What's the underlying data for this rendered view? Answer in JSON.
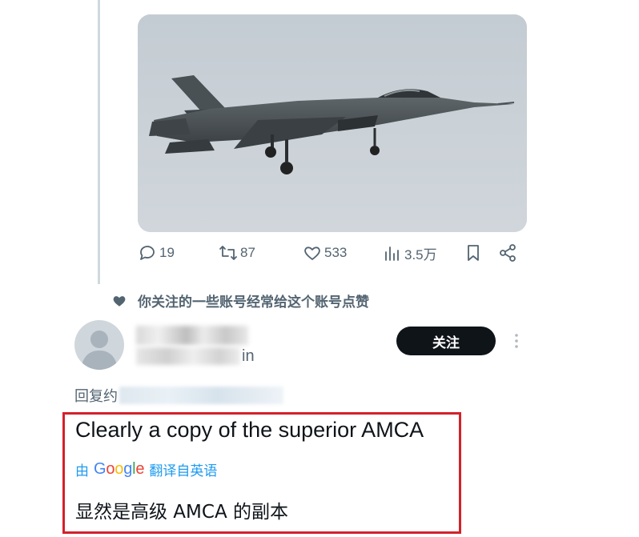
{
  "post": {
    "image_alt": "Fighter jet in flight",
    "actions": {
      "reply_count": "19",
      "retweet_count": "87",
      "like_count": "533",
      "views_count": "3.5万"
    }
  },
  "social_context": "你关注的一些账号经常给这个账号点赞",
  "reply": {
    "handle_tail": "in",
    "follow_label": "关注",
    "replying_to_label": "回复约",
    "text": "Clearly a copy of the superior AMCA",
    "translation": {
      "prefix": "由",
      "provider": "Google",
      "suffix": "翻译自英语",
      "provider_colors": [
        "#4285F4",
        "#EA4335",
        "#FBBC05",
        "#4285F4",
        "#34A853",
        "#EA4335"
      ]
    },
    "translated_text": "显然是高级 AMCA 的副本"
  },
  "colors": {
    "accent": "#1d9bf0",
    "text": "#0f1419",
    "muted": "#536471",
    "highlight_border": "#d3212b",
    "button_bg": "#0f1419"
  }
}
